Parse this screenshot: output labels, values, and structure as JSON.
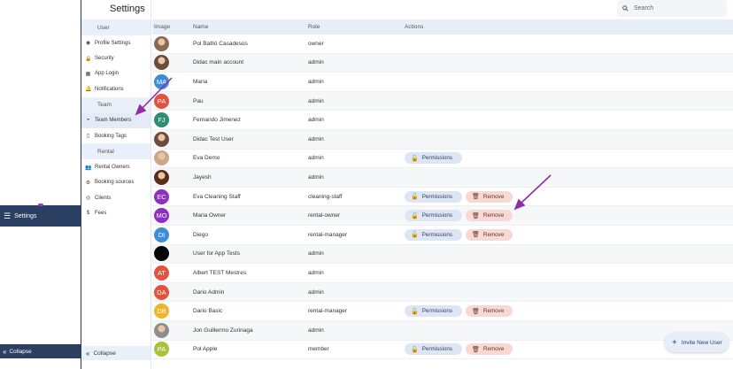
{
  "sidebar_rail": {
    "settings_label": "Settings",
    "collapse_label": "Collapse"
  },
  "menu": {
    "sections": [
      {
        "title": "User",
        "items": [
          {
            "icon": "user-circle-icon",
            "glyph": "◉",
            "label": "Profile Settings"
          },
          {
            "icon": "lock-icon",
            "glyph": "🔒",
            "label": "Security"
          },
          {
            "icon": "grid-icon",
            "glyph": "▦",
            "label": "App Login"
          },
          {
            "icon": "bell-icon",
            "glyph": "🔔",
            "label": "Notifications"
          }
        ]
      },
      {
        "title": "Team",
        "items": [
          {
            "icon": "team-icon",
            "glyph": "◓",
            "label": "Team Members",
            "active": true
          },
          {
            "icon": "bookmark-icon",
            "glyph": "▯",
            "label": "Booking Tags"
          }
        ]
      },
      {
        "title": "Rental",
        "items": [
          {
            "icon": "people-icon",
            "glyph": "👥",
            "label": "Rental Owners"
          },
          {
            "icon": "briefcase-icon",
            "glyph": "⚙",
            "label": "Booking sources"
          },
          {
            "icon": "clients-icon",
            "glyph": "◎",
            "label": "Clients"
          },
          {
            "icon": "dollar-icon",
            "glyph": "$",
            "label": "Fees"
          }
        ]
      }
    ],
    "collapse_label": "Collapse"
  },
  "header": {
    "title": "Settings",
    "search_placeholder": "Search"
  },
  "table": {
    "columns": [
      "Image",
      "Name",
      "Role",
      "Actions"
    ],
    "permissions_label": "Permissions",
    "remove_label": "Remove",
    "rows": [
      {
        "initials": "",
        "avatar_color": "#8a6a55",
        "photo": true,
        "name": "Pol Batlló Casadesús",
        "role": "owner",
        "perm": false,
        "remove": false
      },
      {
        "initials": "",
        "avatar_color": "#6e4b3a",
        "photo": true,
        "name": "Didac main account",
        "role": "admin",
        "perm": false,
        "remove": false
      },
      {
        "initials": "MA",
        "avatar_color": "#3b8ed6",
        "name": "Maria",
        "role": "admin",
        "perm": false,
        "remove": false
      },
      {
        "initials": "PA",
        "avatar_color": "#e0533c",
        "name": "Pau",
        "role": "admin",
        "perm": false,
        "remove": false
      },
      {
        "initials": "FJ",
        "avatar_color": "#2f8c74",
        "name": "Fernando Jimenez",
        "role": "admin",
        "perm": false,
        "remove": false
      },
      {
        "initials": "",
        "avatar_color": "#6e4b3a",
        "photo": true,
        "name": "Didac Test User",
        "role": "admin",
        "perm": false,
        "remove": false
      },
      {
        "initials": "",
        "avatar_color": "#c9a98a",
        "photo": true,
        "name": "Eva Demo",
        "role": "admin",
        "perm": true,
        "remove": false
      },
      {
        "initials": "",
        "avatar_color": "#5a2d1a",
        "photo": true,
        "name": "Jayesh",
        "role": "admin",
        "perm": false,
        "remove": false
      },
      {
        "initials": "EC",
        "avatar_color": "#8e2fc0",
        "name": "Eva Cleaning Staff",
        "role": "cleaning-staff",
        "perm": true,
        "remove": true
      },
      {
        "initials": "MO",
        "avatar_color": "#8e2fc0",
        "name": "Maria Owner",
        "role": "rental-owner",
        "perm": true,
        "remove": true
      },
      {
        "initials": "DI",
        "avatar_color": "#3b8ed6",
        "name": "Diego",
        "role": "rental-manager",
        "perm": true,
        "remove": true
      },
      {
        "initials": "",
        "avatar_color": "#050505",
        "name": "User for App Tests",
        "role": "admin",
        "perm": false,
        "remove": false
      },
      {
        "initials": "AT",
        "avatar_color": "#e0533c",
        "name": "Albert TEST Mestres",
        "role": "admin",
        "perm": false,
        "remove": false
      },
      {
        "initials": "DA",
        "avatar_color": "#e0533c",
        "name": "Dario Admin",
        "role": "admin",
        "perm": false,
        "remove": false
      },
      {
        "initials": "DB",
        "avatar_color": "#f0b429",
        "name": "Dario Basic",
        "role": "rental-manager",
        "perm": true,
        "remove": true
      },
      {
        "initials": "",
        "avatar_color": "#8d8d8d",
        "photo": true,
        "name": "Jon Guillermo Zurinaga",
        "role": "admin",
        "perm": false,
        "remove": false
      },
      {
        "initials": "PA",
        "avatar_color": "#a8c33a",
        "name": "Pol Apple",
        "role": "member",
        "perm": true,
        "remove": true
      }
    ]
  },
  "invite_label": "Invite New User",
  "colors": {
    "rail": "#2b3f63",
    "annotation": "#8e2fa8"
  }
}
